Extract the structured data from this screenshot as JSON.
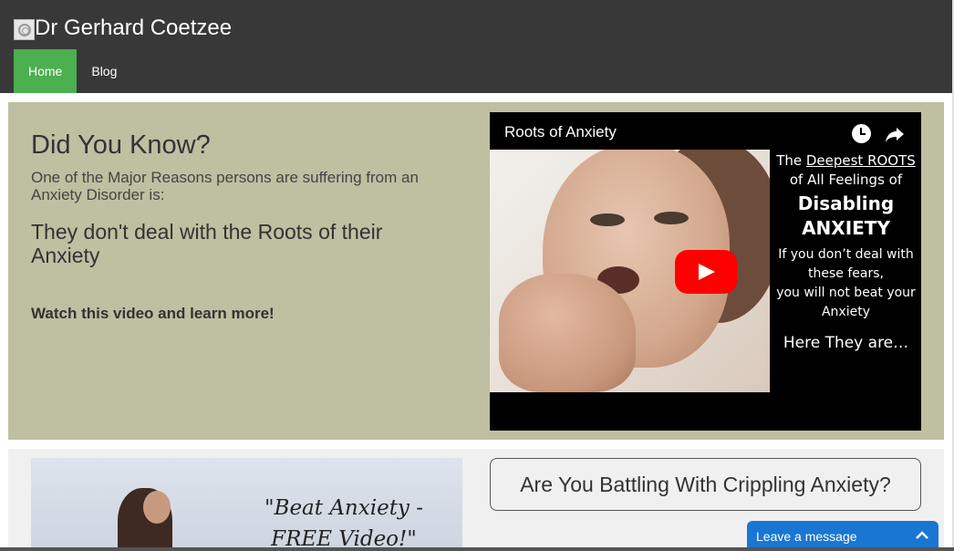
{
  "site": {
    "title": "Dr Gerhard Coetzee"
  },
  "nav": {
    "items": [
      {
        "label": "Home",
        "active": true
      },
      {
        "label": "Blog",
        "active": false
      }
    ]
  },
  "colors": {
    "header_bg": "#383838",
    "nav_active": "#4caf50",
    "panel_bg": "#bfbfa1",
    "chat_bg": "#1976d2",
    "play_red": "#ff0000"
  },
  "did_you_know": {
    "title": "Did You Know?",
    "text": "One of the Major Reasons persons are suffering from an Anxiety Disorder is:",
    "roots": "They don't deal with the Roots of their Anxiety",
    "cta": "Watch this video and learn more!"
  },
  "video": {
    "title": "Roots of Anxiety",
    "icons": {
      "watch_later": "clock-icon",
      "share": "share-icon",
      "play": "play-icon"
    },
    "overlay": {
      "line1_prefix": "The ",
      "line1_underlined": "Deepest ROOTS",
      "line2": "of All Feelings of",
      "line3": "Disabling",
      "line4": "ANXIETY",
      "line5": "If you don’t deal with these fears,",
      "line6": "you will not beat your Anxiety",
      "line7": "Here They are…"
    }
  },
  "promo": {
    "line1": "\"Beat Anxiety -",
    "line2": "FREE Video!\""
  },
  "battle": {
    "heading": "Are You Battling With Crippling Anxiety?"
  },
  "chat": {
    "label": "Leave a message",
    "icon": "chevron-up-icon"
  }
}
